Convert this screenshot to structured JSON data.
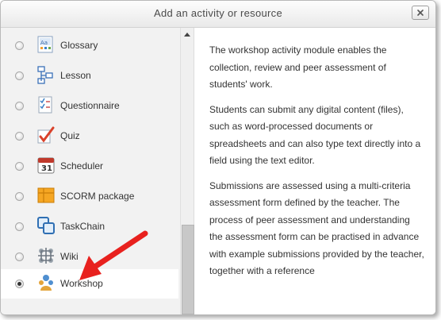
{
  "dialog": {
    "title": "Add an activity or resource",
    "close_label": ""
  },
  "modules": [
    {
      "label": "Glossary",
      "icon": "glossary-icon",
      "selected": false
    },
    {
      "label": "Lesson",
      "icon": "lesson-icon",
      "selected": false
    },
    {
      "label": "Questionnaire",
      "icon": "questionnaire-icon",
      "selected": false
    },
    {
      "label": "Quiz",
      "icon": "quiz-icon",
      "selected": false
    },
    {
      "label": "Scheduler",
      "icon": "scheduler-icon",
      "selected": false
    },
    {
      "label": "SCORM package",
      "icon": "scorm-package-icon",
      "selected": false
    },
    {
      "label": "TaskChain",
      "icon": "taskchain-icon",
      "selected": false
    },
    {
      "label": "Wiki",
      "icon": "wiki-icon",
      "selected": false
    },
    {
      "label": "Workshop",
      "icon": "workshop-icon",
      "selected": true
    }
  ],
  "description": {
    "paragraphs": [
      "The workshop activity module enables the collection, review and peer assessment of students' work.",
      "Students can submit any digital content (files), such as word-processed documents or spreadsheets and can also type text directly into a field using the text editor.",
      "Submissions are assessed using a multi-criteria assessment form defined by the teacher. The process of peer assessment and understanding the assessment form can be practised in advance with example submissions provided by the teacher, together with a reference"
    ]
  },
  "annotation": {
    "arrow_color": "#e8211e"
  }
}
